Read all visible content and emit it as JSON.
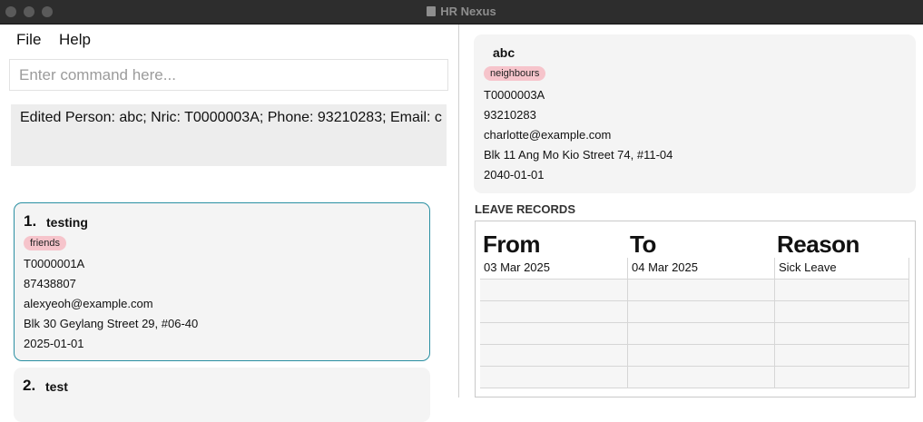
{
  "window": {
    "title": "HR Nexus"
  },
  "menu": {
    "file": "File",
    "help": "Help"
  },
  "command": {
    "placeholder": "Enter command here..."
  },
  "result": {
    "text": "Edited Person: abc; Nric: T0000003A; Phone: 93210283; Email: c"
  },
  "persons": [
    {
      "index": "1.",
      "name": "testing",
      "tag": "friends",
      "nric": "T0000001A",
      "phone": "87438807",
      "email": "alexyeoh@example.com",
      "address": "Blk 30 Geylang Street 29, #06-40",
      "date": "2025-01-01"
    },
    {
      "index": "2.",
      "name": "test"
    }
  ],
  "detail": {
    "name": "abc",
    "tag": "neighbours",
    "nric": "T0000003A",
    "phone": "93210283",
    "email": "charlotte@example.com",
    "address": "Blk 11 Ang Mo Kio Street 74, #11-04",
    "date": "2040-01-01"
  },
  "leave": {
    "title": "LEAVE RECORDS",
    "headers": {
      "from": "From",
      "to": "To",
      "reason": "Reason"
    },
    "rows": [
      {
        "from": "03 Mar 2025",
        "to": "04 Mar 2025",
        "reason": "Sick Leave"
      }
    ]
  },
  "colors": {
    "tag": "#f6c4cb",
    "selected_border": "#2a8fa2",
    "card_bg": "#f4f4f4",
    "titlebar": "#2d2d2d"
  }
}
